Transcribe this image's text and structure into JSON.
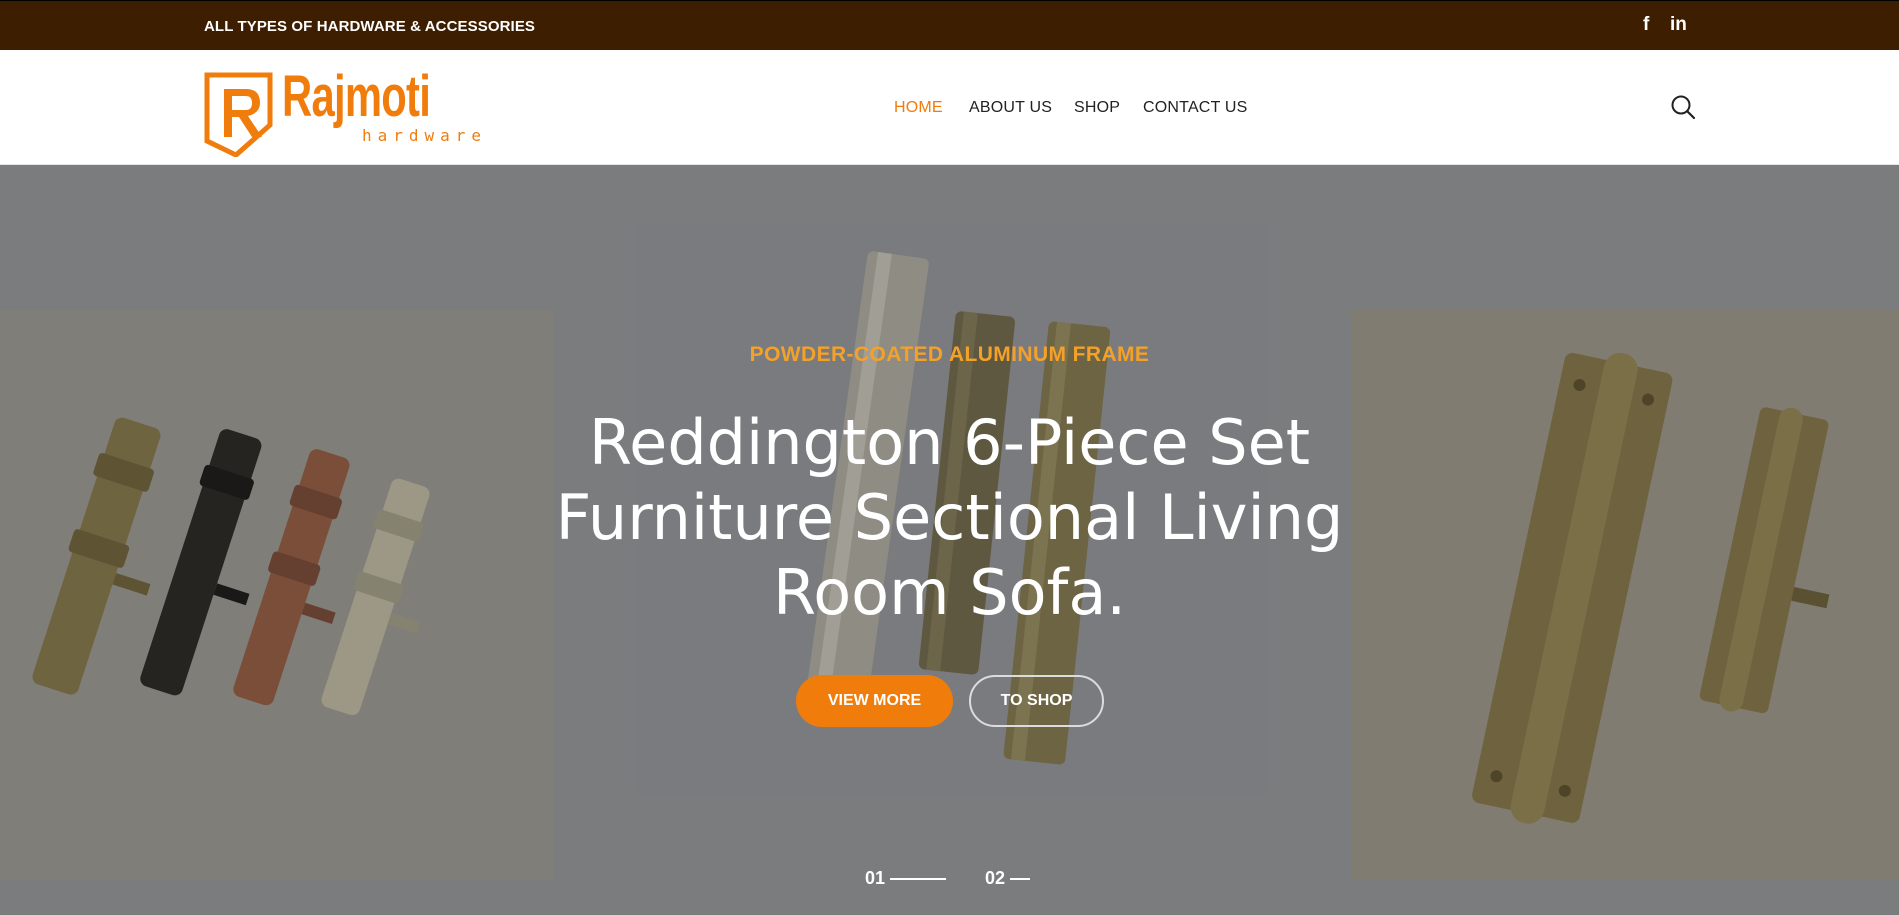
{
  "topbar": {
    "tagline": "ALL TYPES OF HARDWARE & ACCESSORIES",
    "social": {
      "facebook": "f",
      "linkedin": "in"
    }
  },
  "logo": {
    "word": "Rajmoti",
    "sub": "hardware"
  },
  "nav": {
    "items": [
      "HOME",
      "ABOUT US",
      "SHOP",
      "CONTACT US"
    ],
    "active": "HOME"
  },
  "hero": {
    "eyebrow": "POWDER-COATED ALUMINUM FRAME",
    "title_lines": [
      "Reddington 6-Piece Set",
      "Furniture Sectional Living",
      "Room Sofa."
    ],
    "primary_button": "VIEW MORE",
    "secondary_button": "TO SHOP",
    "slides": [
      "01",
      "02"
    ]
  },
  "colors": {
    "accent": "#f07c0c",
    "topbar": "#3d1e00",
    "eyebrow": "#f4a12a"
  }
}
